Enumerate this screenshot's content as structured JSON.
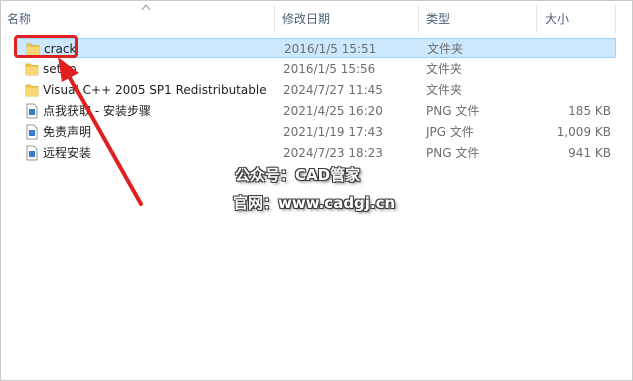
{
  "columns": {
    "name": "名称",
    "date": "修改日期",
    "type": "类型",
    "size": "大小"
  },
  "files": [
    {
      "name": "crack",
      "date": "2016/1/5 15:51",
      "type": "文件夹",
      "size": "",
      "icon": "folder-icon"
    },
    {
      "name": "setup",
      "date": "2016/1/5 15:56",
      "type": "文件夹",
      "size": "",
      "icon": "folder-icon"
    },
    {
      "name": "Visual C++ 2005 SP1 Redistributable",
      "date": "2024/7/27 11:45",
      "type": "文件夹",
      "size": "",
      "icon": "folder-icon"
    },
    {
      "name": "点我获取 - 安装步骤",
      "date": "2021/4/25 16:20",
      "type": "PNG 文件",
      "size": "185 KB",
      "icon": "image-file-icon"
    },
    {
      "name": "免责声明",
      "date": "2021/1/19 17:43",
      "type": "JPG 文件",
      "size": "1,009 KB",
      "icon": "image-file-icon"
    },
    {
      "name": "远程安装",
      "date": "2024/7/23 18:23",
      "type": "PNG 文件",
      "size": "941 KB",
      "icon": "image-file-icon"
    }
  ],
  "watermark": {
    "line1": "公众号：CAD管家",
    "line2": "官网：www.cadgj.cn"
  },
  "colors": {
    "selection_bg": "#cce8ff",
    "selection_border": "#99d1ff",
    "annotation_red": "#e02020",
    "folder_yellow": "#f4c752"
  }
}
